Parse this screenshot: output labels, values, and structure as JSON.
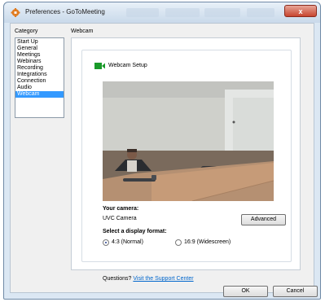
{
  "window": {
    "title": "Preferences - GoToMeeting",
    "close_label": "x"
  },
  "category": {
    "label": "Category",
    "items": [
      "Start Up",
      "General",
      "Meetings",
      "Webinars",
      "Recording",
      "Integrations",
      "Connection",
      "Audio",
      "Webcam"
    ],
    "selected": "Webcam"
  },
  "webcam": {
    "section_label": "Webcam",
    "group_title": "Webcam Setup",
    "camera_label": "Your camera:",
    "camera_name": "UVC Camera",
    "advanced_label": "Advanced",
    "format_label": "Select a display format:",
    "format_options": [
      "4:3 (Normal)",
      "16:9 (Widescreen)"
    ],
    "selected_format": "4:3 (Normal)",
    "questions_text": "Questions?",
    "support_link": "Visit the Support Center"
  },
  "buttons": {
    "ok": "OK",
    "cancel": "Cancel"
  },
  "colors": {
    "selection": "#3399ff",
    "link": "#0066cc",
    "webcam_icon": "#1a9a2a",
    "close_button": "#c7452f"
  },
  "icons": [
    "gear-icon",
    "webcam-icon",
    "close-icon"
  ]
}
